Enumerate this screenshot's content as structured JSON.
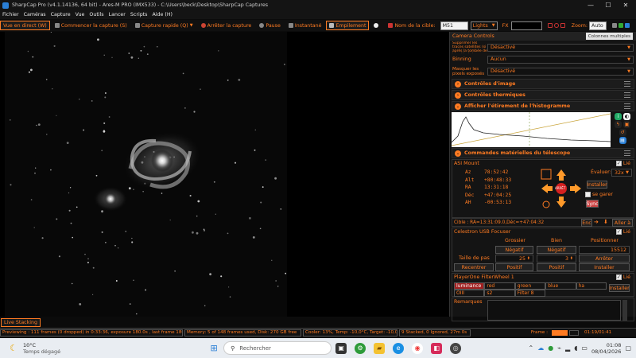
{
  "window": {
    "title": "SharpCap Pro (v4.1.14136, 64 bit) - Ares-M PRO (IMX533) - C:\\Users\\beck\\Desktop\\SharpCap Captures",
    "minimize": "—",
    "maximize": "☐",
    "close": "✕"
  },
  "menu": [
    "Fichier",
    "Caméras",
    "Capture",
    "Vue",
    "Outils",
    "Lancer",
    "Scripts",
    "Aide (H)"
  ],
  "toolbar": {
    "live": "Vue en direct (W)",
    "start_capture": "Commencer la capture (S)",
    "quick_capture": "Capture rapide (Q)",
    "stop_capture": "Arrêter la capture",
    "pause": "Pause",
    "snapshot": "Instantané",
    "pointing": "Empilement",
    "target_label": "Nom de la cible:",
    "target_value": "M51",
    "frame_type": "Lights",
    "fx_label": "FX",
    "zoom_label": "Zoom:",
    "zoom_value": "Auto"
  },
  "right_panel": {
    "header": "Camera Controls",
    "multi_button": "Colonnes multiples",
    "settings": [
      {
        "label": "Supprimer les traces satellites (si après la tombée de la nuit) réel",
        "value": "Désactivé"
      },
      {
        "label": "Binning",
        "value": "Aucun"
      },
      {
        "label": "Masquer les pixels exposés",
        "value": "Désactivé"
      }
    ],
    "sections": {
      "image_controls": "Contrôles d'image",
      "thermal_controls": "Contrôles thermiques",
      "histogram": "Afficher l'étirement de l'histogramme",
      "telescope": "Commandes matérielles du télescope"
    },
    "mount": {
      "name": "ASI Mount",
      "connected_label": "Lié",
      "az_label": "Az",
      "az": "78:52:42",
      "alt_label": "Alt",
      "alt": "+80:48:33",
      "ra_label": "RA",
      "ra": "13:31:18",
      "dec_label": "Déc",
      "dec": "+47:04:25",
      "ah_label": "AH",
      "ah": "-00:53:13",
      "rate_label": "Évaluer:",
      "rate": "32x",
      "install_button": "Installer",
      "park_label": "se garer",
      "stop_button": "ARRÊT",
      "sync_button": "Sync",
      "target_line": "Cible : RA=13:31:09.0,Déc=+47:04:32",
      "end_button": "Enc",
      "goto_button": "Aller à"
    },
    "focuser": {
      "name": "Celestron USB Focuser",
      "connected_label": "Lié",
      "coarse": "Grossier",
      "fine": "Bien",
      "position": "Positionner",
      "neg": "Négatif",
      "pos": "Positif",
      "position_value": "15512",
      "step_label": "Taille de pas",
      "step_coarse": "25",
      "step_fine": "3",
      "stop_button": "Arrêter",
      "install_button": "Installer",
      "recenter": "Recentrer"
    },
    "filterwheel": {
      "name": "PlayerOne FilterWheel 1",
      "connected_label": "Lié",
      "filters": [
        "luminance",
        "red",
        "green",
        "blue",
        "ha",
        "OIII",
        "s2",
        "Filter 8"
      ],
      "install_button": "Installer"
    },
    "remarks_label": "Remarques"
  },
  "live_tab": "Live Stacking",
  "status": {
    "preview": "Previewing : 111 frames (0 dropped) in 0:33:36, exposure 180.0s , last frame 180.0s",
    "memory": "Memory: 5 of 148 frames used, Disk: 270 GB free",
    "cooler": "Cooler: 13%, Temp: -10,0°C, Target: -10,0°",
    "stack": "9 Stacked, 0 Ignored, 27m 0s",
    "frame_label": "Frame :",
    "frame_time": "01:19/01:41"
  },
  "taskbar": {
    "temp": "10°C",
    "weather": "Temps dégagé",
    "search_placeholder": "Rechercher",
    "time": "01:08",
    "date": "08/04/2026"
  },
  "colors": {
    "accent": "#ff7b22",
    "taskbar": "#e9edf2"
  },
  "icons": [
    "sharpcap-icon",
    "windows-start-icon",
    "search-icon",
    "edge-icon",
    "explorer-icon",
    "chrome-icon",
    "sharpcap-taskbar-icon"
  ]
}
